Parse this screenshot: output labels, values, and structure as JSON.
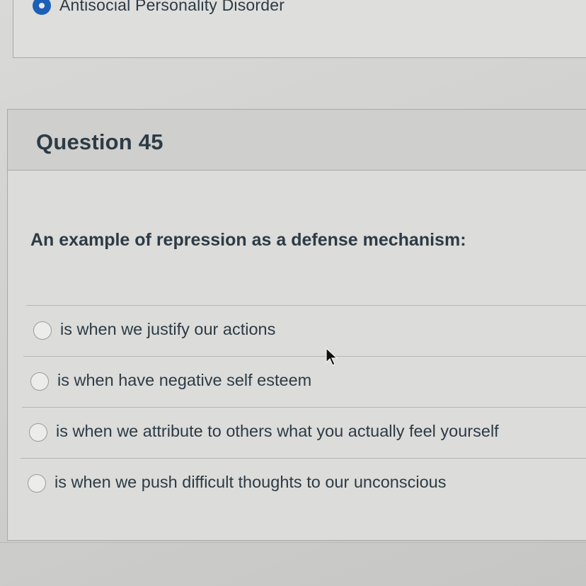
{
  "previous_question": {
    "selected_answer": "Antisocial Personality Disorder"
  },
  "question": {
    "title": "Question 45",
    "text": "An example of repression as a defense mechanism:",
    "answers": [
      {
        "label": "is when we justify our actions",
        "selected": false
      },
      {
        "label": "is when have negative self esteem",
        "selected": false
      },
      {
        "label": "is when we attribute to others what you actually feel yourself",
        "selected": false
      },
      {
        "label": "is when we push difficult thoughts to our unconscious",
        "selected": false
      }
    ]
  },
  "colors": {
    "accent": "#1c5fb8",
    "text": "#2d3b45",
    "border": "#a9a9a7"
  }
}
